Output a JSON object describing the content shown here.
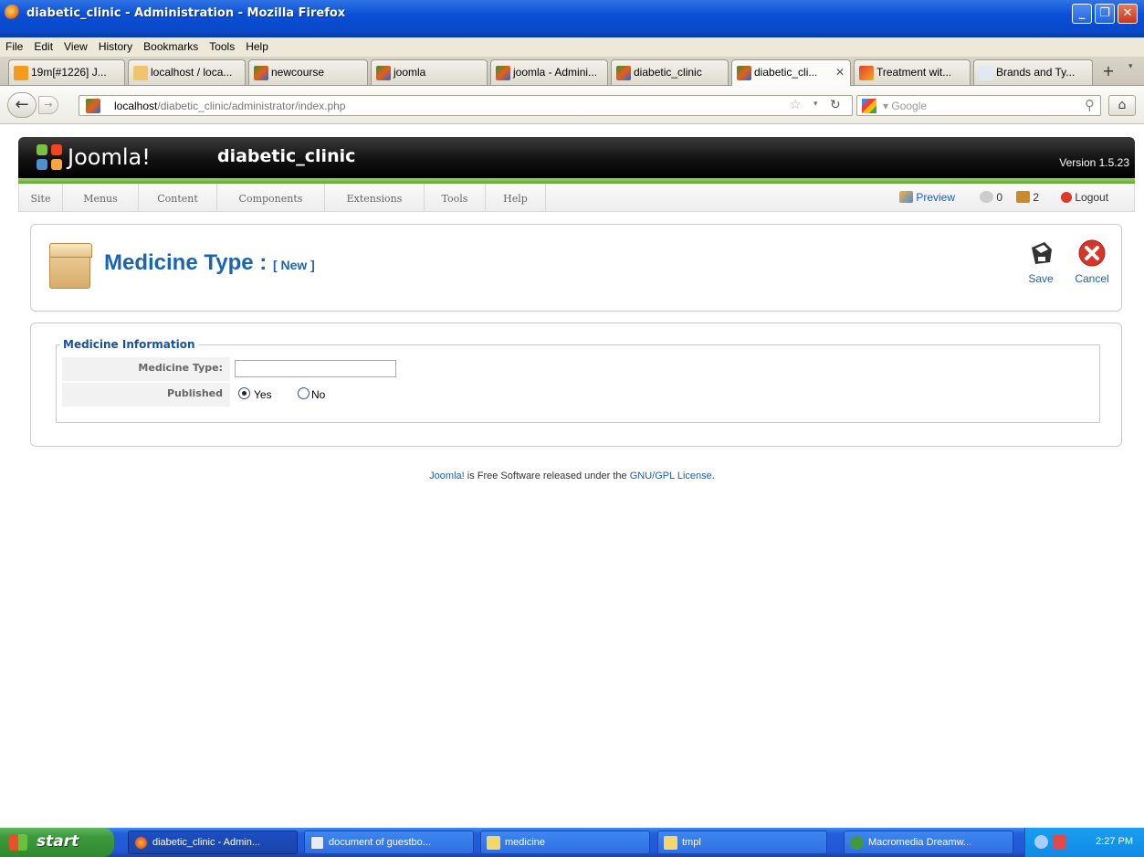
{
  "window": {
    "title": "diabetic_clinic - Administration - Mozilla Firefox"
  },
  "menubar": {
    "items": [
      "File",
      "Edit",
      "View",
      "History",
      "Bookmarks",
      "Tools",
      "Help"
    ]
  },
  "tabs": [
    {
      "label": "19m[#1226] J..."
    },
    {
      "label": "localhost / loca..."
    },
    {
      "label": "newcourse"
    },
    {
      "label": "joomla"
    },
    {
      "label": "joomla - Admini..."
    },
    {
      "label": "diabetic_clinic"
    },
    {
      "label": "diabetic_cli...",
      "active": true
    },
    {
      "label": "Treatment wit..."
    },
    {
      "label": "Brands and Ty..."
    }
  ],
  "navbar": {
    "url_host": "localhost",
    "url_path": "/diabetic_clinic/administrator/index.php",
    "search_placeholder": "Google"
  },
  "joomla": {
    "logo_text": "Joomla!",
    "site_name": "diabetic_clinic",
    "version": "Version 1.5.23",
    "menu": [
      "Site",
      "Menus",
      "Content",
      "Components",
      "Extensions",
      "Tools",
      "Help"
    ],
    "status": {
      "preview": "Preview",
      "messages": "0",
      "users": "2",
      "logout": "Logout"
    }
  },
  "toolbar": {
    "title": "Medicine Type :",
    "subtitle": "[ New ]",
    "save_label": "Save",
    "cancel_label": "Cancel"
  },
  "form": {
    "legend": "Medicine Information",
    "medicine_type_label": "Medicine Type:",
    "medicine_type_value": "",
    "published_label": "Published",
    "yes_label": "Yes",
    "no_label": "No",
    "published_selected": "Yes"
  },
  "footer": {
    "prefix": "Joomla!",
    "middle": " is Free Software released under the ",
    "link": "GNU/GPL License",
    "suffix": "."
  },
  "taskbar": {
    "start_label": "start",
    "tasks": [
      {
        "label": "diabetic_clinic - Admin..."
      },
      {
        "label": "document of guestbo..."
      },
      {
        "label": "medicine"
      },
      {
        "label": "tmpl"
      },
      {
        "label": "Macromedia Dreamw..."
      }
    ],
    "clock": "2:27 PM"
  },
  "colors": {
    "accent": "#1a64b6",
    "green_bar": "#5ea32d",
    "title_bar": "#0a4fd6"
  }
}
